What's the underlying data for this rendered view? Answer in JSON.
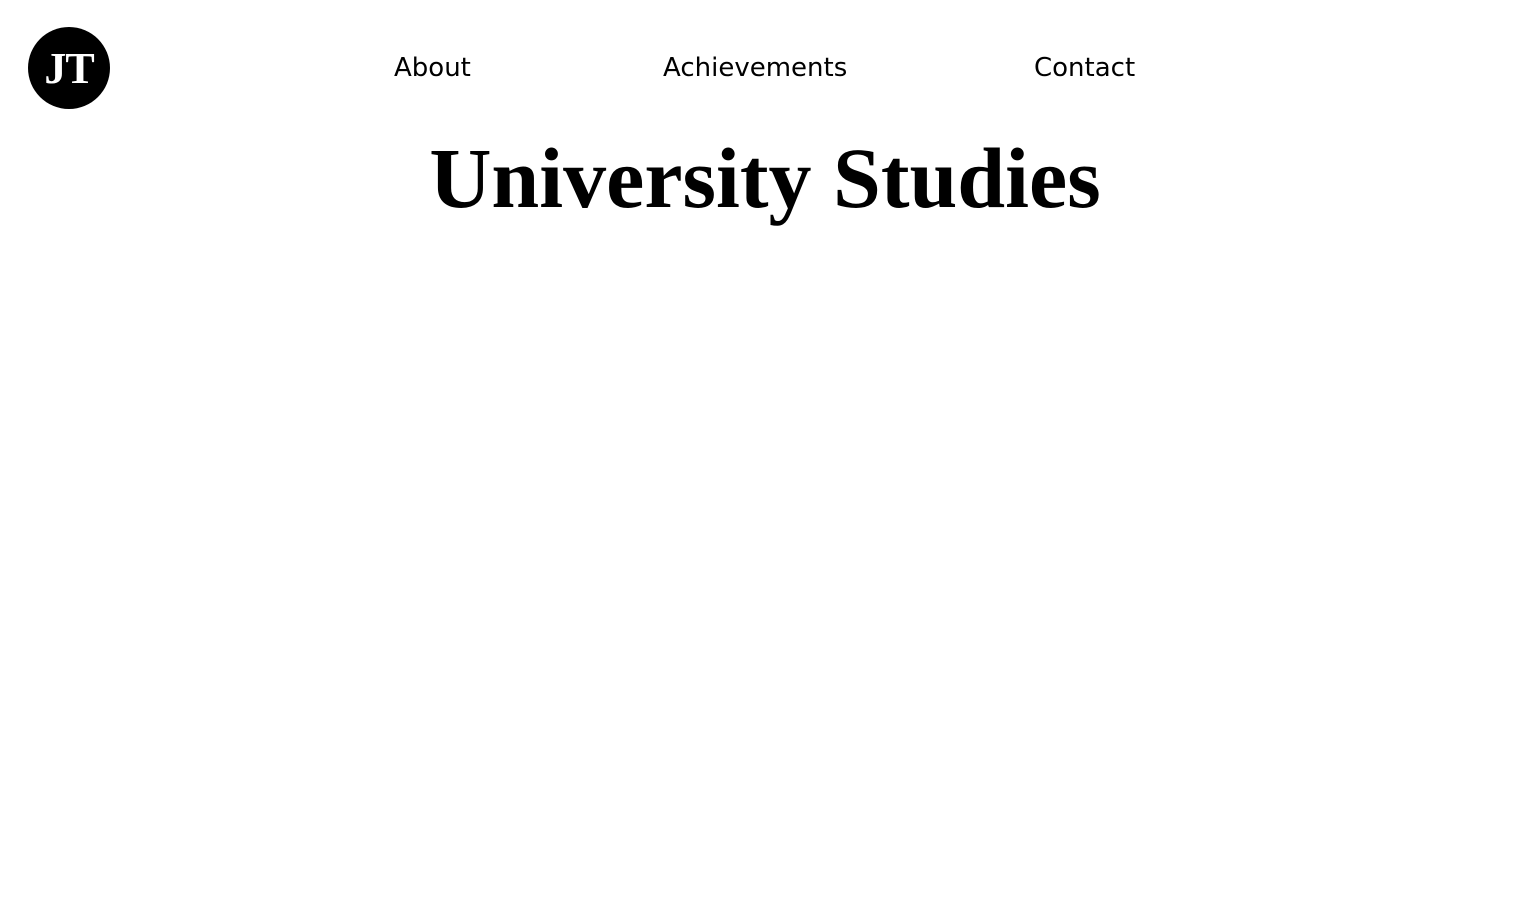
{
  "header": {
    "logo_text": "JT",
    "nav": [
      {
        "label": "About"
      },
      {
        "label": "Achievements"
      },
      {
        "label": "Contact"
      }
    ]
  },
  "main": {
    "title": "University Studies"
  },
  "colors": {
    "background": "#ffffff",
    "text": "#000000",
    "logo_background": "#000000",
    "logo_text": "#ffffff"
  }
}
